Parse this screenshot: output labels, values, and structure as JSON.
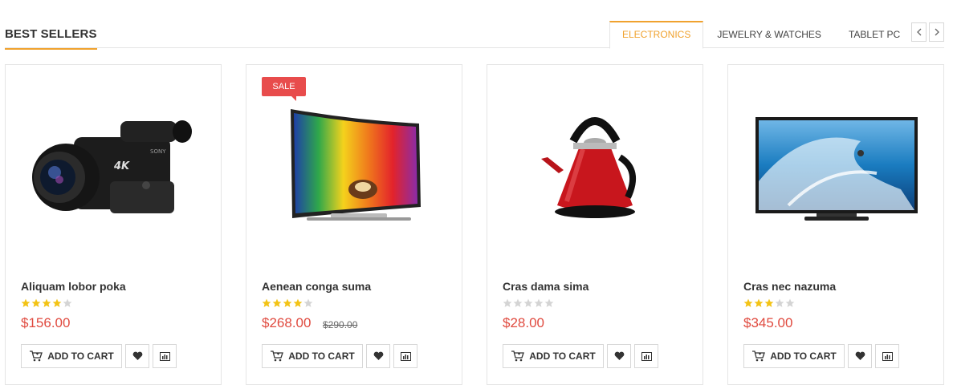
{
  "section": {
    "title": "BEST SELLERS",
    "tabs": [
      "ELECTRONICS",
      "JEWELRY & WATCHES",
      "TABLET PC"
    ],
    "active_tab": "ELECTRONICS"
  },
  "colors": {
    "accent": "#f0a22e",
    "price": "#e04a3f",
    "sale_badge": "#e84c4c",
    "star_on": "#f3c315",
    "star_off": "#d4d4d4"
  },
  "add_to_cart_label": "ADD TO CART",
  "products": [
    {
      "name": "Aliquam lobor poka",
      "rating": 4,
      "price": "$156.00",
      "old_price": "",
      "sale": "",
      "image": "camcorder"
    },
    {
      "name": "Aenean conga suma",
      "rating": 4,
      "price": "$268.00",
      "old_price": "$290.00",
      "sale": "SALE",
      "image": "curved-tv"
    },
    {
      "name": "Cras dama sima",
      "rating": 0,
      "price": "$28.00",
      "old_price": "",
      "sale": "",
      "image": "kettle"
    },
    {
      "name": "Cras nec nazuma",
      "rating": 3,
      "price": "$345.00",
      "old_price": "",
      "sale": "",
      "image": "flat-tv"
    }
  ]
}
